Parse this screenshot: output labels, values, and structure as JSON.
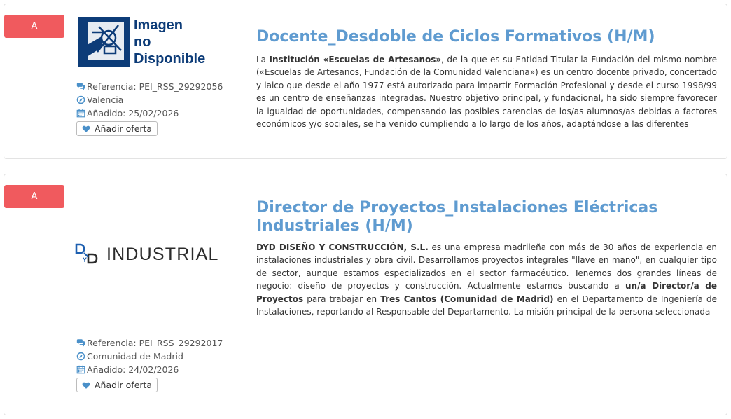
{
  "jobs": [
    {
      "badge": "A",
      "logo_text": [
        "Imagen",
        "no",
        "Disponible"
      ],
      "title": "Docente_Desdoble de Ciclos Formativos (H/M)",
      "desc": [
        {
          "t": "La ",
          "b": false
        },
        {
          "t": "Institución «Escuelas de Artesanos»",
          "b": true
        },
        {
          "t": ", de la que es su Entidad Titular la Fundación del mismo nombre («Escuelas de Artesanos, Fundación de la Comunidad Valenciana») es un centro docente privado, concertado y laico que desde el año 1977 está autorizado para impartir Formación Profesional y desde el curso 1998/99 es un centro de enseñanzas integradas. Nuestro objetivo principal, y fundacional, ha sido siempre favorecer la igualdad de oportunidades, compensando las posibles carencias de los/as alumnos/as debidas a factores económicos y/o sociales, se ha venido cumpliendo a lo largo de los años, adaptándose a las diferentes",
          "b": false
        }
      ],
      "reference": "Referencia: PEI_RSS_29292056",
      "location": "Valencia",
      "added": "Añadido: 25/02/2026",
      "fav_label": "Añadir oferta"
    },
    {
      "badge": "A",
      "logo_text": "INDUSTRIAL",
      "title": "Director de Proyectos_Instalaciones Eléctricas Industriales (H/M)",
      "desc": [
        {
          "t": "DYD DISEÑO Y CONSTRUCCIÓN, S.L.",
          "b": true
        },
        {
          "t": " es una empresa madrileña con más de 30 años de experiencia en instalaciones industriales y obra civil. Desarrollamos proyectos integrales \"llave en mano\", en cualquier tipo de sector, aunque estamos especializados en el sector farmacéutico. Tenemos dos grandes líneas de negocio: diseño de proyectos y construcción. Actualmente estamos buscando a ",
          "b": false
        },
        {
          "t": "un/a Director/a de Proyectos",
          "b": true
        },
        {
          "t": " para trabajar en ",
          "b": false
        },
        {
          "t": "Tres Cantos (Comunidad de Madrid)",
          "b": true
        },
        {
          "t": " en el Departamento de Ingeniería de Instalaciones, reportando al Responsable del Departamento. La misión principal de la persona seleccionada",
          "b": false
        }
      ],
      "reference": "Referencia: PEI_RSS_29292017",
      "location": "Comunidad de Madrid",
      "added": "Añadido: 24/02/2026",
      "fav_label": "Añadir oferta"
    }
  ],
  "colors": {
    "badge": "#f05a5e",
    "title": "#5f9bd0",
    "icon": "#4a90c9",
    "logo_navy": "#0d3c78",
    "logo_text": "#2b2b2b",
    "dyd_blue": "#1d5fb0"
  },
  "icons": [
    "comments-icon",
    "location-icon",
    "calendar-icon",
    "heart-icon"
  ]
}
